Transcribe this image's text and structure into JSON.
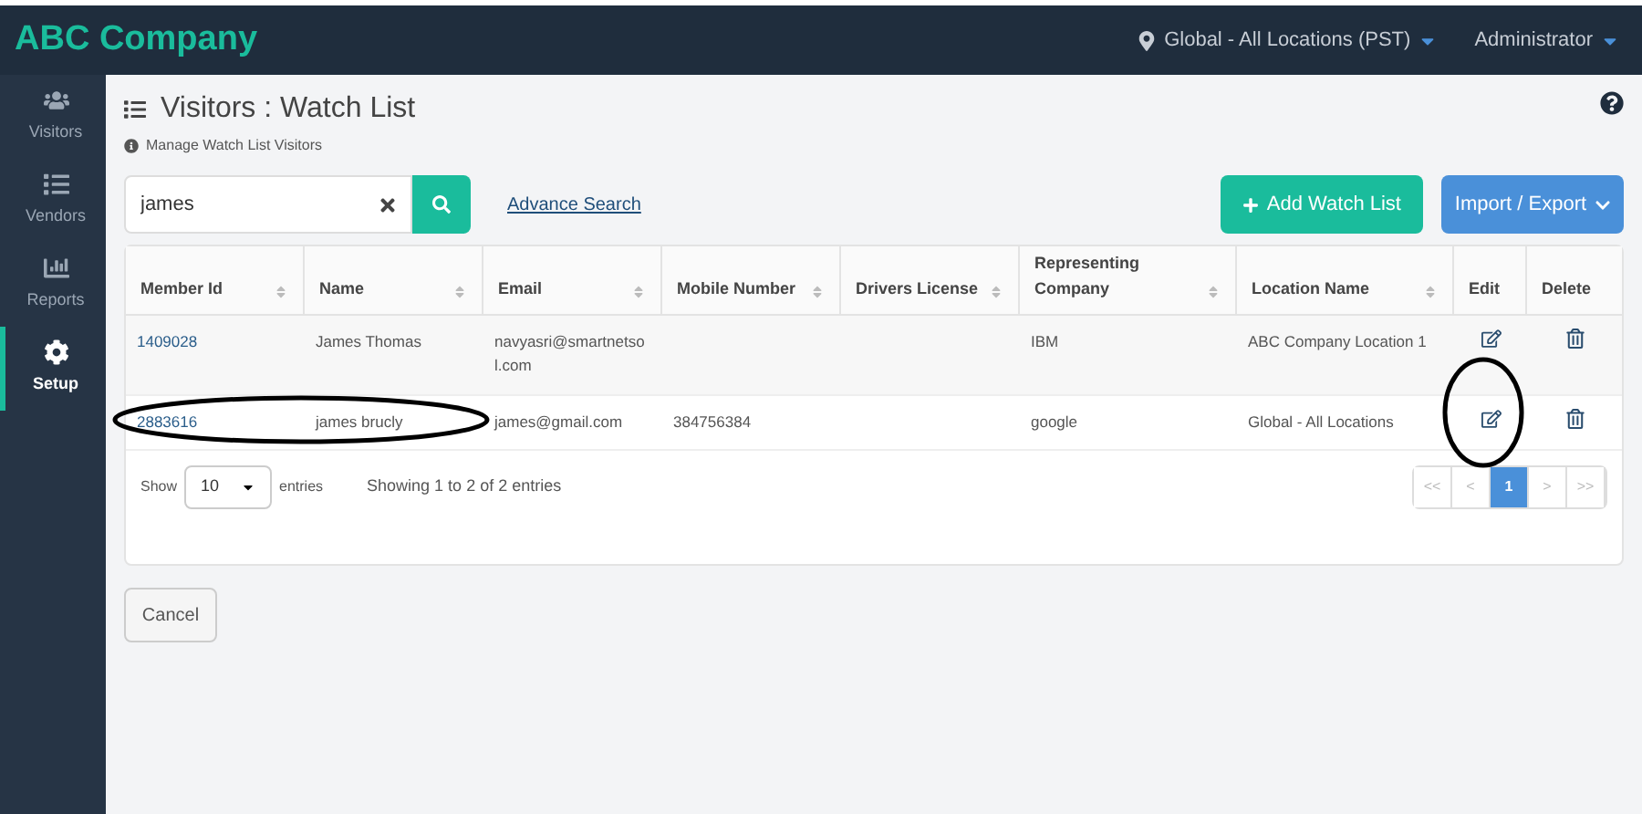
{
  "brand": "ABC Company",
  "topbar": {
    "location": "Global - All Locations (PST)",
    "user": "Administrator"
  },
  "sidebar": {
    "items": [
      {
        "label": "Visitors",
        "selected": false
      },
      {
        "label": "Vendors",
        "selected": false
      },
      {
        "label": "Reports",
        "selected": false
      },
      {
        "label": "Setup",
        "selected": true
      }
    ]
  },
  "page": {
    "title": "Visitors : Watch List",
    "subtitle": "Manage Watch List Visitors"
  },
  "search": {
    "value": "james",
    "advance_link": "Advance Search"
  },
  "buttons": {
    "add": "Add Watch List",
    "import": "Import / Export",
    "cancel": "Cancel"
  },
  "table": {
    "columns": [
      "Member Id",
      "Name",
      "Email",
      "Mobile Number",
      "Drivers License",
      "Representing Company",
      "Location Name",
      "Edit",
      "Delete"
    ],
    "rows": [
      {
        "member_id": "1409028",
        "name": "James Thomas",
        "email": "navyasri@smartnetsol.com",
        "company": "IBM",
        "location": "ABC Company Location 1",
        "circled": false
      },
      {
        "member_id": "2883616",
        "name": "james brucly",
        "email": "james@gmail.com",
        "mobile": "384756384",
        "company": "google",
        "location": "Global - All Locations",
        "circled": true
      }
    ]
  },
  "footer": {
    "show": "Show",
    "page_size": "10",
    "entries": "entries",
    "info": "Showing 1 to 2 of 2 entries",
    "pages": [
      {
        "label": "<<",
        "selected": false
      },
      {
        "label": "<",
        "selected": false
      },
      {
        "label": "1",
        "selected": true
      },
      {
        "label": ">",
        "selected": false
      },
      {
        "label": ">>",
        "selected": false
      }
    ]
  }
}
